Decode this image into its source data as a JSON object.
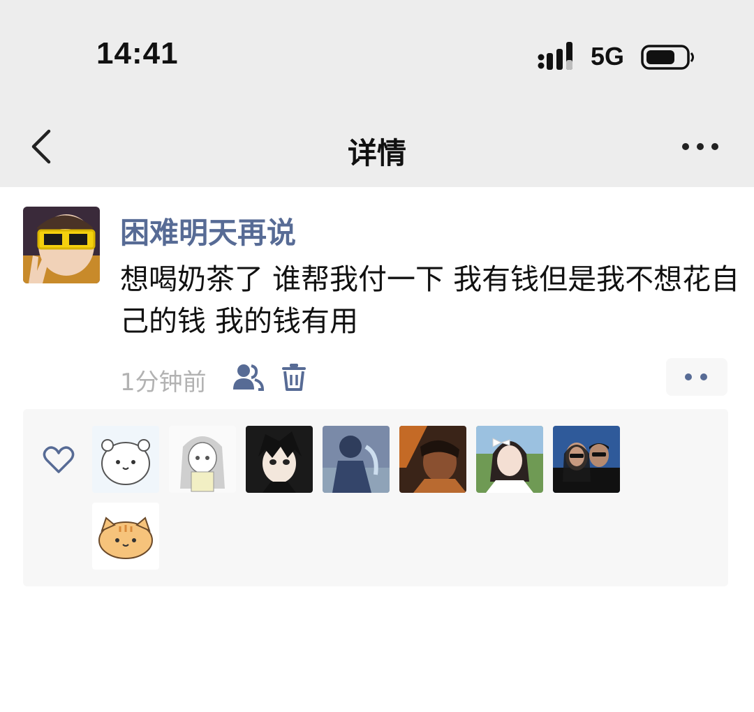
{
  "status_bar": {
    "time": "14:41",
    "network": "5G",
    "icons": [
      "signal-icon",
      "battery-icon"
    ]
  },
  "nav": {
    "title": "详情",
    "icons": [
      "back-chevron-icon",
      "more-dots-icon"
    ]
  },
  "post": {
    "author": "困难明天再说",
    "text": "想喝奶茶了 谁帮我付一下 我有钱但是我不想花自己的钱 我的钱有用",
    "time": "1分钟前",
    "icons": [
      "privacy-friends-icon",
      "trash-icon",
      "comment-like-dots-icon"
    ]
  },
  "likes": {
    "icon": "heart-outline-icon",
    "liker_avatars": [
      "white-cat-sticker",
      "anime-girl-sketch",
      "anime-boy-black-hair",
      "person-blue-hoodie",
      "warm-tone-portrait",
      "girl-with-bow",
      "couple-sunglasses",
      "orange-cat-sticker"
    ]
  },
  "colors": {
    "header_bg": "#ededed",
    "link_blue": "#576b95",
    "muted_gray": "#b2b2b2",
    "panel_bg": "#f7f7f7"
  }
}
